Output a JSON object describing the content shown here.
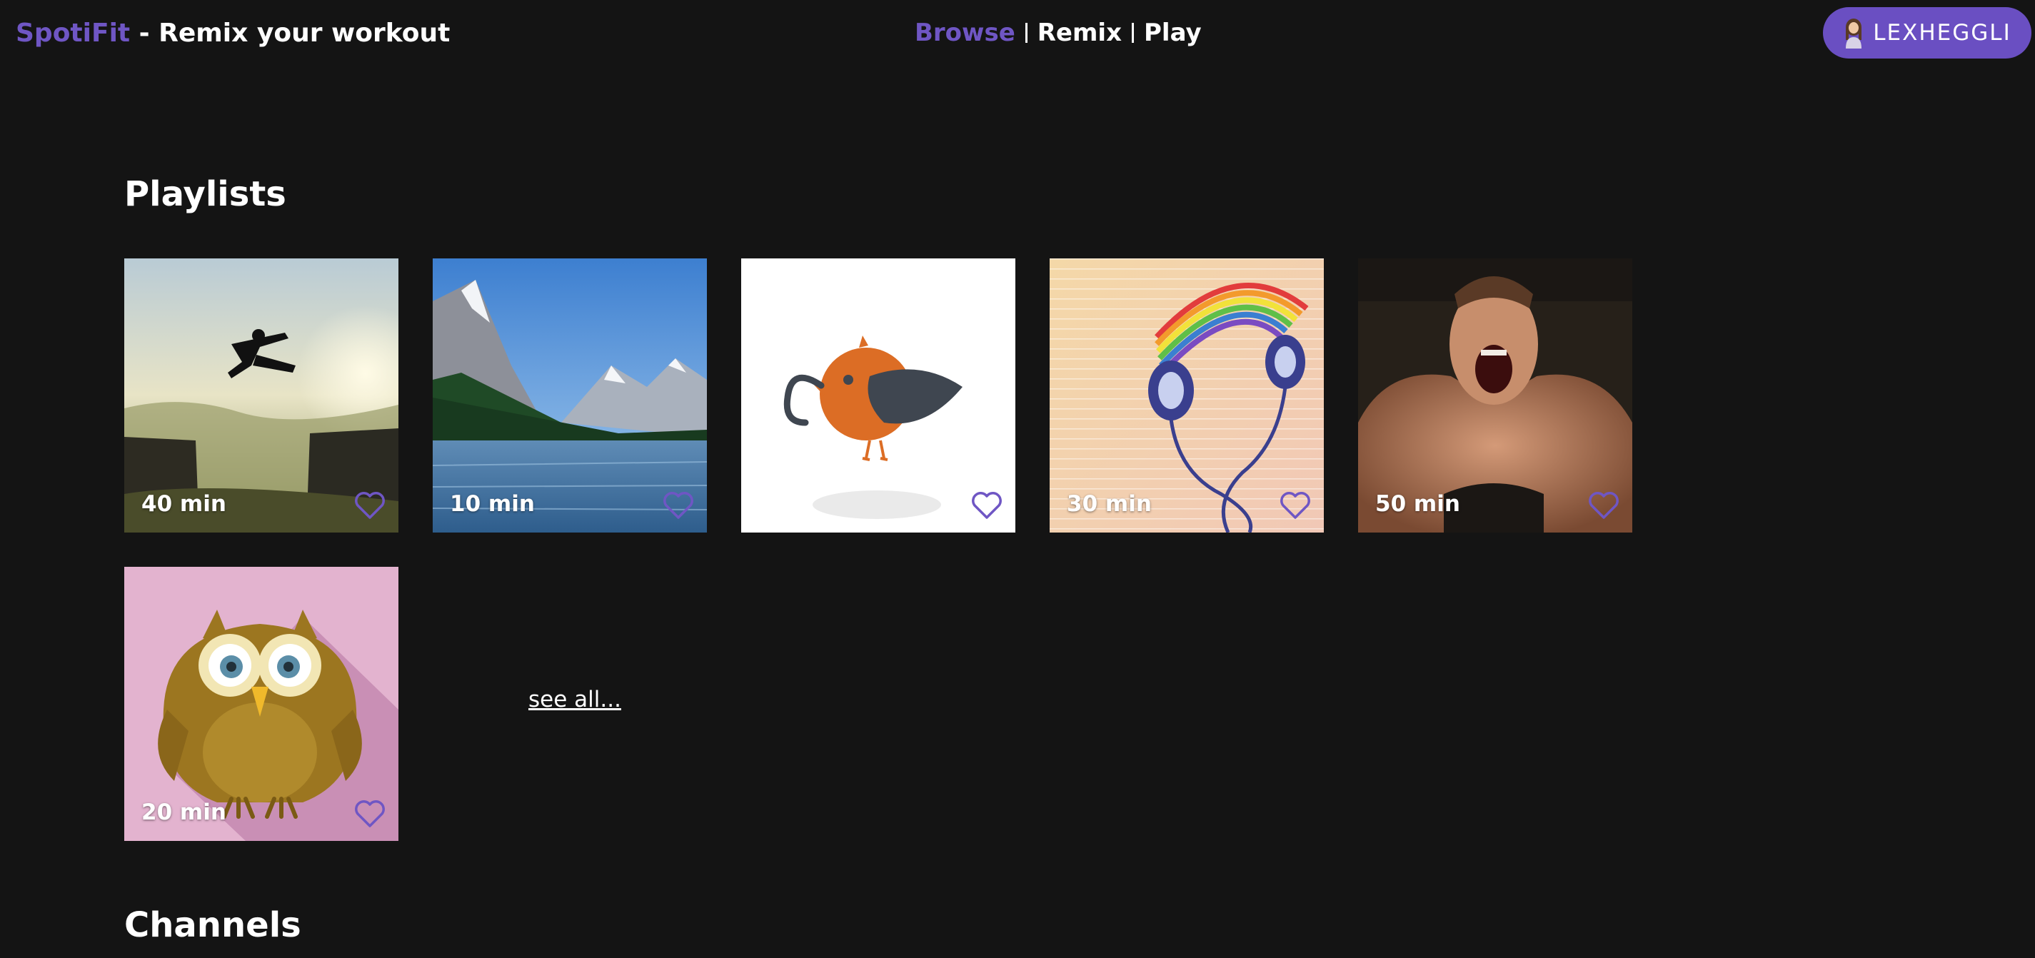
{
  "header": {
    "brand_name": "SpotiFit",
    "brand_tagline": " - Remix your workout",
    "nav": {
      "browse": "Browse",
      "remix": "Remix",
      "play": "Play"
    },
    "user": {
      "username": "LEXHEGGLI",
      "avatar_icon": "person-avatar-icon"
    }
  },
  "colors": {
    "accent": "#6f56c4",
    "background": "#141414",
    "user_button": "#6a4fc2"
  },
  "sections": {
    "playlists_title": "Playlists",
    "channels_title": "Channels"
  },
  "playlists": [
    {
      "duration": "40 min",
      "image": "cliff-jump-sunset",
      "favorite": false
    },
    {
      "duration": "10 min",
      "image": "mountain-lake",
      "favorite": false
    },
    {
      "duration": "",
      "image": "orange-bird-with-worm",
      "favorite": false
    },
    {
      "duration": "30 min",
      "image": "rainbow-headphones",
      "favorite": false
    },
    {
      "duration": "50 min",
      "image": "shouting-athlete",
      "favorite": false
    },
    {
      "duration": "20 min",
      "image": "owl-on-pink",
      "favorite": false
    }
  ],
  "see_all_label": "see all..."
}
